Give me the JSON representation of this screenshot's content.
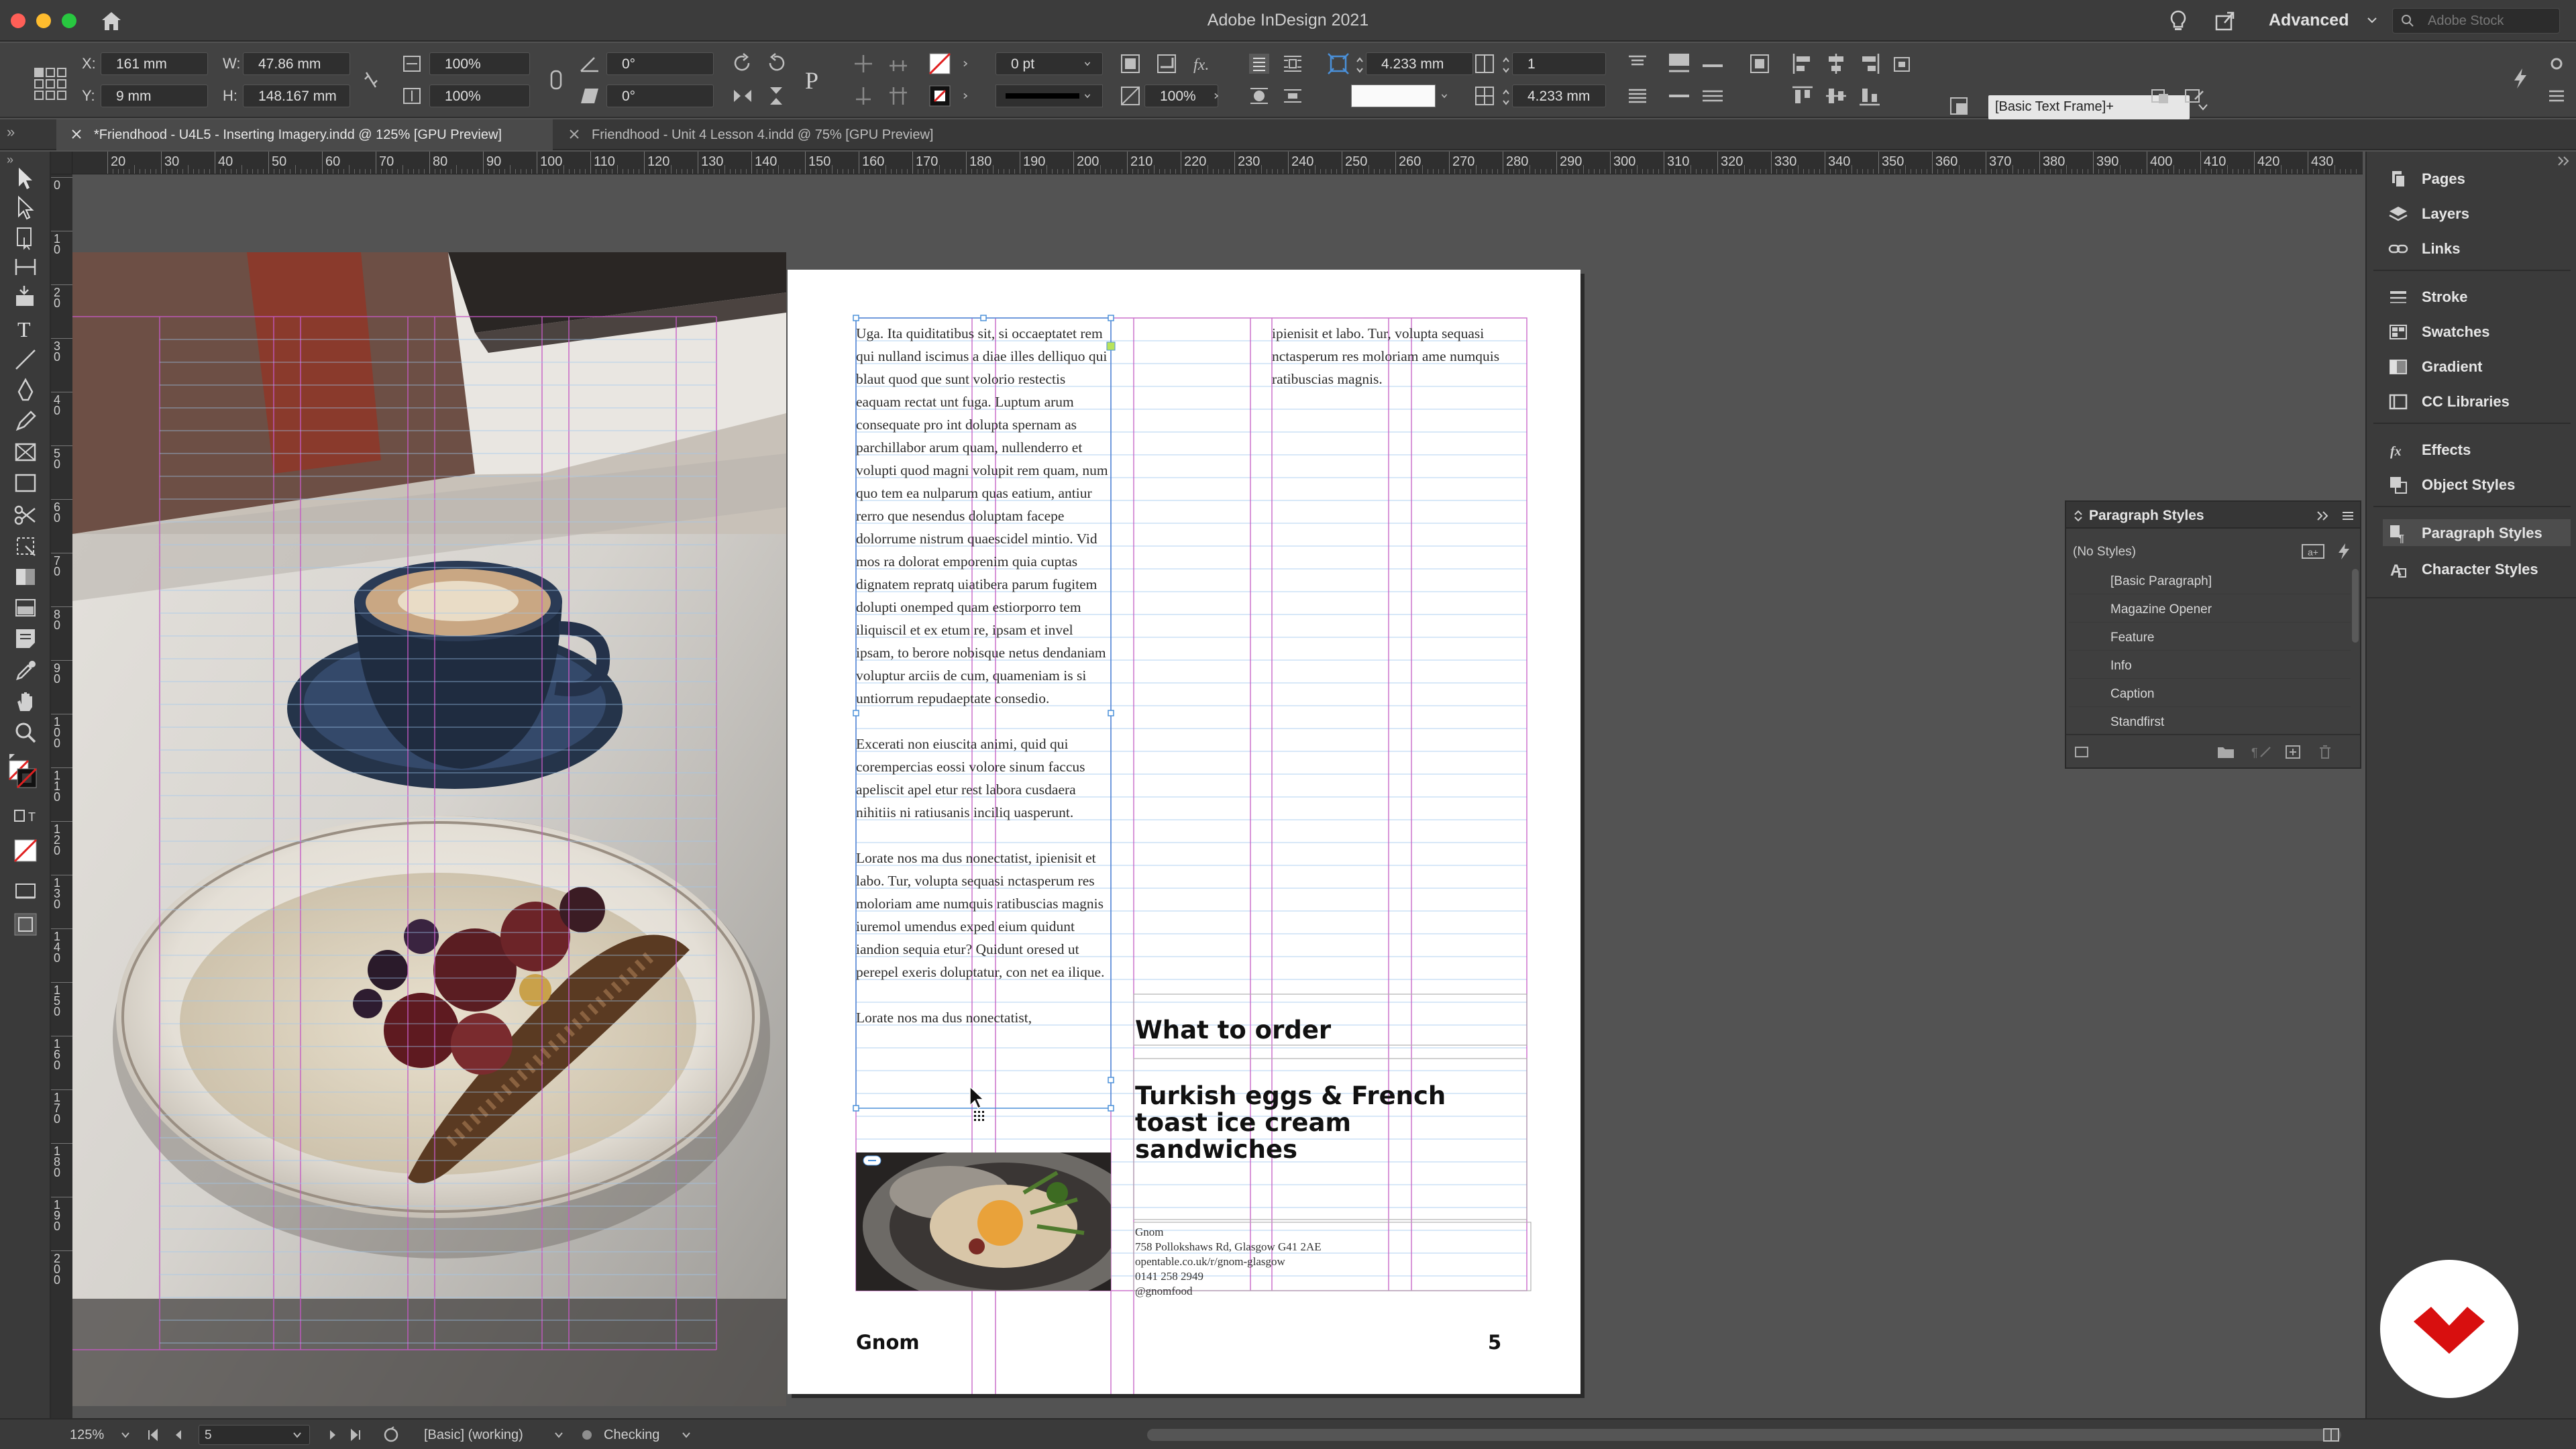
{
  "app": {
    "title": "Adobe InDesign 2021",
    "workspace": "Advanced",
    "stock_search_placeholder": "Adobe Stock"
  },
  "colors": {
    "traffic_close": "#ff5f57",
    "traffic_min": "#febc2e",
    "traffic_max": "#28c840",
    "frame_edge": "#4a90d9",
    "margin_guide": "#c45ac4",
    "baseline_guide": "#9fc7ef",
    "brand_red": "#d80f0f"
  },
  "control": {
    "x_label": "X:",
    "x_value": "161 mm",
    "y_label": "Y:",
    "y_value": "9 mm",
    "w_label": "W:",
    "w_value": "47.86 mm",
    "h_label": "H:",
    "h_value": "148.167 mm",
    "scale_x": "100%",
    "scale_y": "100%",
    "rotate": "0°",
    "shear": "0°",
    "stroke_weight": "0 pt",
    "opacity": "100%",
    "gutter_top": "4.233 mm",
    "gutter_bottom": "4.233 mm",
    "columns": "1",
    "frame_style": "[Basic Text Frame]+"
  },
  "tabs": [
    {
      "label": "*Friendhood - U4L5 - Inserting Imagery.indd @ 125% [GPU Preview]"
    },
    {
      "label": "Friendhood - Unit 4 Lesson 4.indd @ 75% [GPU Preview]"
    }
  ],
  "ruler": {
    "h_ticks": [
      "20",
      "30",
      "40",
      "50",
      "60",
      "70",
      "80",
      "90",
      "100",
      "110",
      "120",
      "130",
      "140",
      "150",
      "160",
      "170",
      "180",
      "190",
      "200",
      "210",
      "220",
      "230",
      "240",
      "250",
      "260",
      "270",
      "280",
      "290",
      "300",
      "310",
      "320",
      "330",
      "340",
      "350",
      "360",
      "370",
      "380",
      "390",
      "400",
      "410",
      "420",
      "430"
    ],
    "v_ticks": [
      "0",
      "10",
      "20",
      "30",
      "40",
      "50",
      "60",
      "70",
      "80",
      "90",
      "100",
      "110",
      "120",
      "130",
      "140",
      "150",
      "160",
      "170",
      "180",
      "190",
      "200"
    ]
  },
  "document": {
    "col1_para1": "Uga. Ita quiditatibus sit, si occaeptatet rem qui nulland iscimus a diae illes delliquo qui blaut quod que sunt volorio restectis eaquam rectat unt fuga. Luptum arum consequate pro int dolupta spernam as parchillabor arum quam, nullenderro et volupti quod magni volupit rem quam, num quo tem ea nulparum quas eatium, antiur rerro que nesendus doluptam facepe dolorrume nistrum quaescidel mintio. Vid mos ra dolorat emporenim quia cuptas dignatem repratq uiatibera parum fugitem dolupti onemped quam estiorporro tem iliquiscil et ex etum re, ipsam et invel ipsam, to berore nobisque netus dendaniam voluptur arciis de cum, quameniam is si untiorrum repudaeptate consedio.",
    "col1_para2": "Excerati non eiuscita animi, quid qui corempercias eossi volore sinum faccus apeliscit apel etur rest labora cusdaera nihitiis ni ratiusanis inciliq uasperunt.",
    "col1_para3": "Lorate nos ma dus nonectatist, ipienisit et labo. Tur, volupta sequasi nctasperum res moloriam ame numquis ratibuscias magnis iuremol umendus exped eium quidunt iandion sequia etur? Quidunt oresed ut perepel exeris doluptatur, con net ea ilique.",
    "col1_para4": "Lorate nos ma dus nonectatist,",
    "col3_text": "ipienisit et labo. Tur, volupta sequasi nctasperum res moloriam ame numquis ratibuscias magnis.",
    "what_to_order": "What to order",
    "dish": "Turkish eggs & French toast ice cream sandwiches",
    "info_lines": [
      "Gnom",
      "758 Pollokshaws Rd, Glasgow G41 2AE",
      "opentable.co.uk/r/gnom-glasgow",
      "0141 258 2949",
      "@gnomfood"
    ],
    "footer_name": "Gnom",
    "page_number": "5"
  },
  "dock": [
    {
      "label": "Pages",
      "icon": "pages-icon"
    },
    {
      "label": "Layers",
      "icon": "layers-icon"
    },
    {
      "label": "Links",
      "icon": "links-icon"
    },
    {
      "label": "Stroke",
      "icon": "stroke-icon"
    },
    {
      "label": "Swatches",
      "icon": "swatches-icon"
    },
    {
      "label": "Gradient",
      "icon": "gradient-icon"
    },
    {
      "label": "CC Libraries",
      "icon": "cc-libraries-icon"
    },
    {
      "label": "Effects",
      "icon": "effects-icon"
    },
    {
      "label": "Object Styles",
      "icon": "object-styles-icon"
    },
    {
      "label": "Paragraph Styles",
      "icon": "paragraph-styles-icon"
    },
    {
      "label": "Character Styles",
      "icon": "character-styles-icon"
    }
  ],
  "paragraph_styles": {
    "title": "Paragraph Styles",
    "current": "(No Styles)",
    "items": [
      "[Basic Paragraph]",
      "Magazine Opener",
      "Feature",
      "Info",
      "Caption",
      "Standfirst"
    ]
  },
  "status": {
    "zoom": "125%",
    "page": "5",
    "preflight_profile": "[Basic] (working)",
    "preflight_state": "Checking"
  }
}
